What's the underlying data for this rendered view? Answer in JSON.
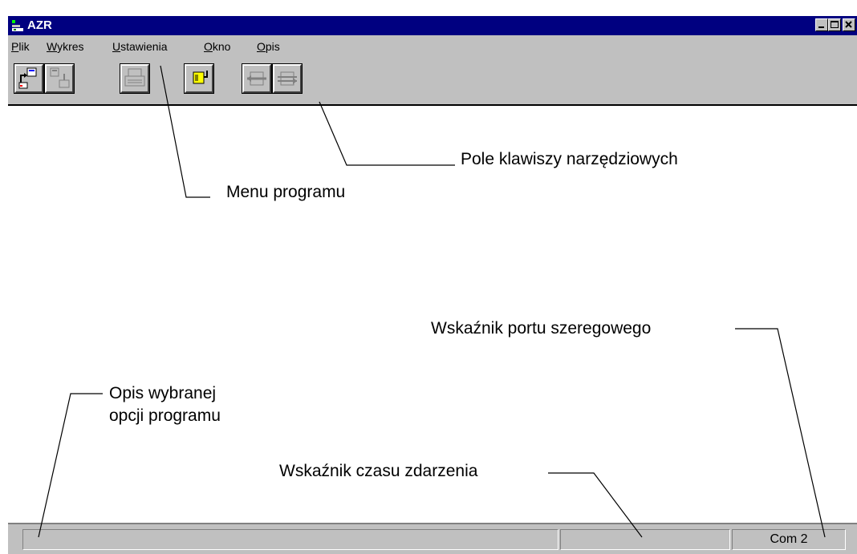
{
  "window": {
    "title": "AZR",
    "title_bar_color": "#000080",
    "controls": [
      "minimize-icon",
      "maximize-icon",
      "close-icon"
    ]
  },
  "menu": {
    "items": [
      {
        "label": "Plik",
        "accel": "P"
      },
      {
        "label": "Wykres",
        "accel": "W"
      },
      {
        "label": "Ustawienia",
        "accel": "U"
      },
      {
        "label": "Okno",
        "accel": "O"
      },
      {
        "label": "Opis",
        "accel": "O"
      }
    ]
  },
  "toolbar": {
    "buttons": [
      "load-data-icon",
      "save-data-icon",
      "print-icon",
      "port-icon",
      "connect-icon",
      "disconnect-icon"
    ]
  },
  "statusbar": {
    "description": "",
    "event_time": "",
    "port": "Com 2"
  },
  "annotations": {
    "toolbar_field": "Pole klawiszy narzędziowych",
    "program_menu": "Menu programu",
    "serial_port_indicator": "Wskaźnik portu szeregowego",
    "option_description_line1": "Opis wybranej",
    "option_description_line2": "opcji programu",
    "event_time_indicator": "Wskaźnik czasu zdarzenia"
  }
}
